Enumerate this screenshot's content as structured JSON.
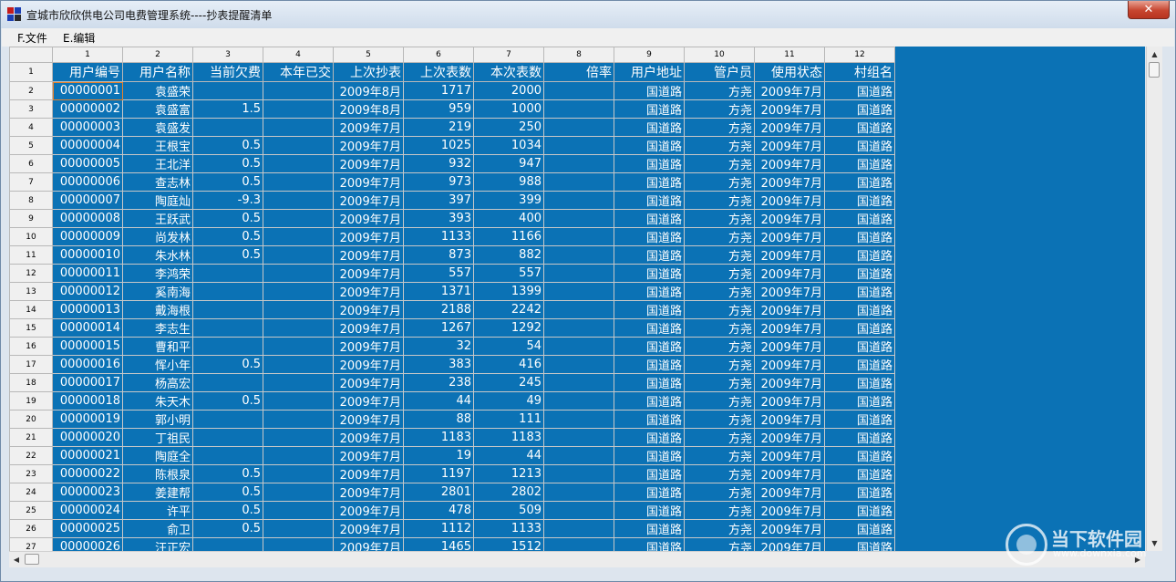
{
  "window": {
    "title": "宣城市欣欣供电公司电费管理系统----抄表提醒清单",
    "close": "✕"
  },
  "menu": [
    {
      "label": "F.文件"
    },
    {
      "label": "E.编辑"
    }
  ],
  "columns": [
    {
      "num": "1",
      "label": "用户编号"
    },
    {
      "num": "2",
      "label": "用户名称"
    },
    {
      "num": "3",
      "label": "当前欠费"
    },
    {
      "num": "4",
      "label": "本年已交"
    },
    {
      "num": "5",
      "label": "上次抄表"
    },
    {
      "num": "6",
      "label": "上次表数"
    },
    {
      "num": "7",
      "label": "本次表数"
    },
    {
      "num": "8",
      "label": "倍率"
    },
    {
      "num": "9",
      "label": "用户地址"
    },
    {
      "num": "10",
      "label": "管户员"
    },
    {
      "num": "11",
      "label": "使用状态"
    },
    {
      "num": "12",
      "label": "村组名"
    }
  ],
  "header_row_num": "1",
  "rows": [
    {
      "n": "2",
      "c": [
        "00000001",
        "袁盛荣",
        "",
        "",
        "2009年8月",
        "1717",
        "2000",
        "",
        "国道路",
        "方尧",
        "2009年7月",
        "国道路"
      ]
    },
    {
      "n": "3",
      "c": [
        "00000002",
        "袁盛富",
        "1.5",
        "",
        "2009年8月",
        "959",
        "1000",
        "",
        "国道路",
        "方尧",
        "2009年7月",
        "国道路"
      ]
    },
    {
      "n": "4",
      "c": [
        "00000003",
        "袁盛发",
        "",
        "",
        "2009年7月",
        "219",
        "250",
        "",
        "国道路",
        "方尧",
        "2009年7月",
        "国道路"
      ]
    },
    {
      "n": "5",
      "c": [
        "00000004",
        "王根宝",
        "0.5",
        "",
        "2009年7月",
        "1025",
        "1034",
        "",
        "国道路",
        "方尧",
        "2009年7月",
        "国道路"
      ]
    },
    {
      "n": "6",
      "c": [
        "00000005",
        "王北洋",
        "0.5",
        "",
        "2009年7月",
        "932",
        "947",
        "",
        "国道路",
        "方尧",
        "2009年7月",
        "国道路"
      ]
    },
    {
      "n": "7",
      "c": [
        "00000006",
        "查志林",
        "0.5",
        "",
        "2009年7月",
        "973",
        "988",
        "",
        "国道路",
        "方尧",
        "2009年7月",
        "国道路"
      ]
    },
    {
      "n": "8",
      "c": [
        "00000007",
        "陶庭灿",
        "-9.3",
        "",
        "2009年7月",
        "397",
        "399",
        "",
        "国道路",
        "方尧",
        "2009年7月",
        "国道路"
      ]
    },
    {
      "n": "9",
      "c": [
        "00000008",
        "王跃武",
        "0.5",
        "",
        "2009年7月",
        "393",
        "400",
        "",
        "国道路",
        "方尧",
        "2009年7月",
        "国道路"
      ]
    },
    {
      "n": "10",
      "c": [
        "00000009",
        "尚发林",
        "0.5",
        "",
        "2009年7月",
        "1133",
        "1166",
        "",
        "国道路",
        "方尧",
        "2009年7月",
        "国道路"
      ]
    },
    {
      "n": "11",
      "c": [
        "00000010",
        "朱水林",
        "0.5",
        "",
        "2009年7月",
        "873",
        "882",
        "",
        "国道路",
        "方尧",
        "2009年7月",
        "国道路"
      ]
    },
    {
      "n": "12",
      "c": [
        "00000011",
        "李鸿荣",
        "",
        "",
        "2009年7月",
        "557",
        "557",
        "",
        "国道路",
        "方尧",
        "2009年7月",
        "国道路"
      ]
    },
    {
      "n": "13",
      "c": [
        "00000012",
        "奚南海",
        "",
        "",
        "2009年7月",
        "1371",
        "1399",
        "",
        "国道路",
        "方尧",
        "2009年7月",
        "国道路"
      ]
    },
    {
      "n": "14",
      "c": [
        "00000013",
        "戴海根",
        "",
        "",
        "2009年7月",
        "2188",
        "2242",
        "",
        "国道路",
        "方尧",
        "2009年7月",
        "国道路"
      ]
    },
    {
      "n": "15",
      "c": [
        "00000014",
        "李志生",
        "",
        "",
        "2009年7月",
        "1267",
        "1292",
        "",
        "国道路",
        "方尧",
        "2009年7月",
        "国道路"
      ]
    },
    {
      "n": "16",
      "c": [
        "00000015",
        "曹和平",
        "",
        "",
        "2009年7月",
        "32",
        "54",
        "",
        "国道路",
        "方尧",
        "2009年7月",
        "国道路"
      ]
    },
    {
      "n": "17",
      "c": [
        "00000016",
        "恽小年",
        "0.5",
        "",
        "2009年7月",
        "383",
        "416",
        "",
        "国道路",
        "方尧",
        "2009年7月",
        "国道路"
      ]
    },
    {
      "n": "18",
      "c": [
        "00000017",
        "杨高宏",
        "",
        "",
        "2009年7月",
        "238",
        "245",
        "",
        "国道路",
        "方尧",
        "2009年7月",
        "国道路"
      ]
    },
    {
      "n": "19",
      "c": [
        "00000018",
        "朱天木",
        "0.5",
        "",
        "2009年7月",
        "44",
        "49",
        "",
        "国道路",
        "方尧",
        "2009年7月",
        "国道路"
      ]
    },
    {
      "n": "20",
      "c": [
        "00000019",
        "郭小明",
        "",
        "",
        "2009年7月",
        "88",
        "111",
        "",
        "国道路",
        "方尧",
        "2009年7月",
        "国道路"
      ]
    },
    {
      "n": "21",
      "c": [
        "00000020",
        "丁祖民",
        "",
        "",
        "2009年7月",
        "1183",
        "1183",
        "",
        "国道路",
        "方尧",
        "2009年7月",
        "国道路"
      ]
    },
    {
      "n": "22",
      "c": [
        "00000021",
        "陶庭全",
        "",
        "",
        "2009年7月",
        "19",
        "44",
        "",
        "国道路",
        "方尧",
        "2009年7月",
        "国道路"
      ]
    },
    {
      "n": "23",
      "c": [
        "00000022",
        "陈根泉",
        "0.5",
        "",
        "2009年7月",
        "1197",
        "1213",
        "",
        "国道路",
        "方尧",
        "2009年7月",
        "国道路"
      ]
    },
    {
      "n": "24",
      "c": [
        "00000023",
        "姜建帮",
        "0.5",
        "",
        "2009年7月",
        "2801",
        "2802",
        "",
        "国道路",
        "方尧",
        "2009年7月",
        "国道路"
      ]
    },
    {
      "n": "25",
      "c": [
        "00000024",
        "许平",
        "0.5",
        "",
        "2009年7月",
        "478",
        "509",
        "",
        "国道路",
        "方尧",
        "2009年7月",
        "国道路"
      ]
    },
    {
      "n": "26",
      "c": [
        "00000025",
        "俞卫",
        "0.5",
        "",
        "2009年7月",
        "1112",
        "1133",
        "",
        "国道路",
        "方尧",
        "2009年7月",
        "国道路"
      ]
    },
    {
      "n": "27",
      "c": [
        "00000026",
        "汪正宏",
        "",
        "",
        "2009年7月",
        "1465",
        "1512",
        "",
        "国道路",
        "方尧",
        "2009年7月",
        "国道路"
      ]
    }
  ],
  "scrollbars": {
    "up": "▲",
    "down": "▼",
    "left": "◀",
    "right": "▶"
  },
  "watermark": {
    "brand": "当下软件园",
    "url": "www.downxia.com"
  },
  "colors": {
    "grid_bg": "#0b72b5",
    "selection": "#e4822c",
    "header_bg": "#f0f0f0"
  }
}
